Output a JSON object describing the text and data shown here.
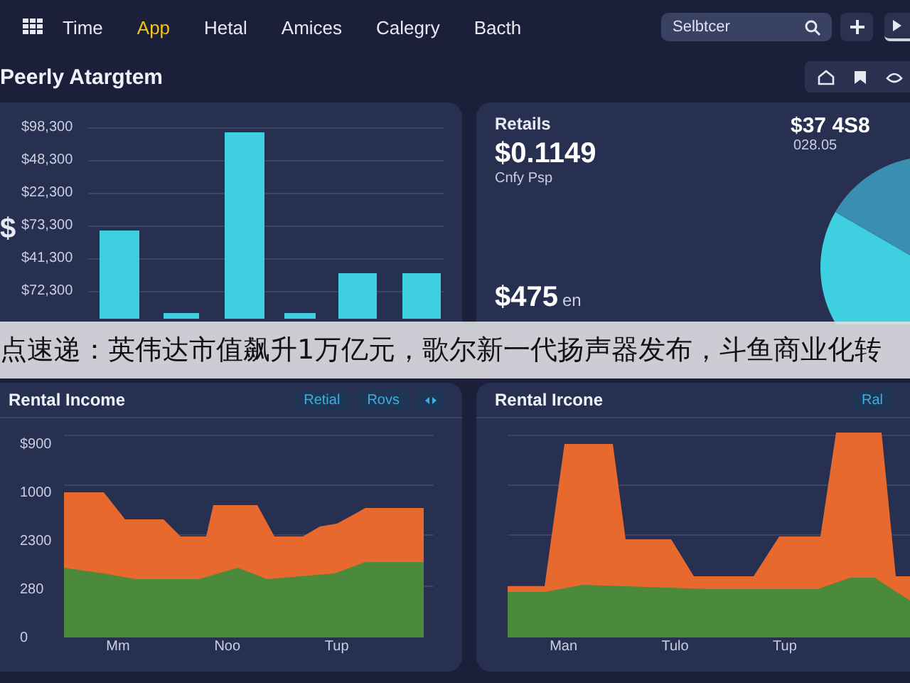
{
  "nav": {
    "items": [
      {
        "label": "Time",
        "selected": false
      },
      {
        "label": "App",
        "selected": true
      },
      {
        "label": "Hetal",
        "selected": false
      },
      {
        "label": "Amices",
        "selected": false
      },
      {
        "label": "Calegry",
        "selected": false
      },
      {
        "label": "Bacth",
        "selected": false
      }
    ],
    "search": {
      "placeholder": "Selbtcer"
    }
  },
  "header": {
    "title": "Peerly Atargtem"
  },
  "bar_card": {
    "axis_symbol": "$",
    "yticks": [
      "$98,300",
      "$48,300",
      "$22,300",
      "$73,300",
      "$41,300",
      "$72,300"
    ]
  },
  "stat_card": {
    "title": "Retails",
    "value": "$0.1149",
    "caption": "Cnfy Psp",
    "side_value": "$37 4S8",
    "side_caption": "028.05",
    "bottom_value": "$475",
    "bottom_unit": "en"
  },
  "area_cards": [
    {
      "title": "Rental Income",
      "kind": "plateau",
      "buttons": [
        "Retial",
        "Rovs"
      ],
      "icon_button": true,
      "yticks": [
        "$900",
        "1000",
        "2300",
        "280",
        "0"
      ],
      "xlabels": [
        "Mm",
        "Noo",
        "Tup"
      ]
    },
    {
      "title": "Rental Ircone",
      "kind": "spikes",
      "buttons": [
        "Ral"
      ],
      "icon_button": false,
      "xlabels": [
        "Man",
        "Tulo",
        "Tup"
      ]
    }
  ],
  "banner": {
    "text": "点速递：英伟达市值飙升1万亿元，歌尔新一代扬声器发布，斗鱼商业化转"
  }
}
